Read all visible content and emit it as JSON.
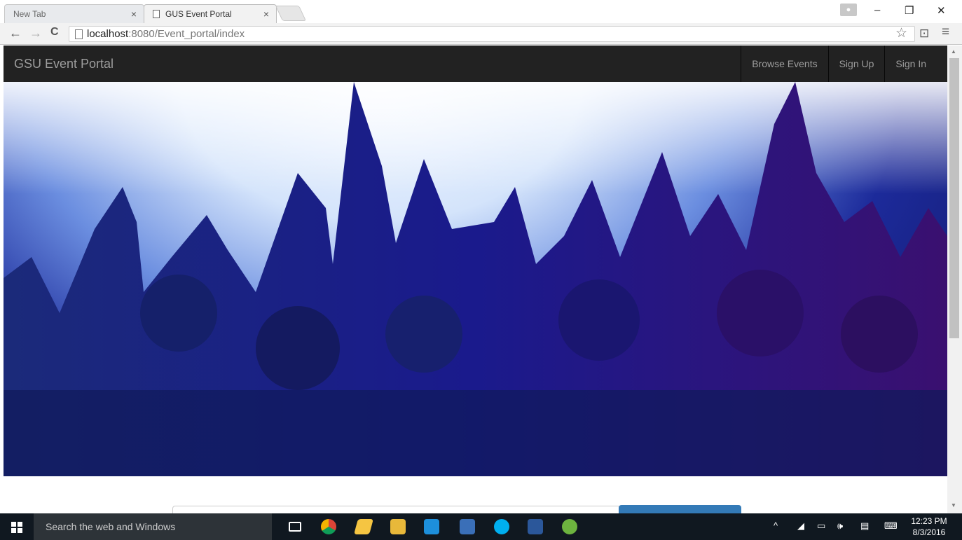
{
  "tabs": [
    {
      "title": "New Tab",
      "close": "×"
    },
    {
      "title": "GUS Event Portal",
      "close": "×"
    }
  ],
  "toolbar": {
    "back": "←",
    "forward": "→",
    "reload": "C",
    "url_host": "localhost",
    "url_path": ":8080/Event_portal/index",
    "star": "☆",
    "cast": "⊡",
    "menu": "≡"
  },
  "window_controls": {
    "minimize": "–",
    "restore": "❐",
    "close": "✕"
  },
  "page": {
    "brand": "GSU Event Portal",
    "nav": [
      "Browse Events",
      "Sign Up",
      "Sign In"
    ]
  },
  "taskbar": {
    "search_placeholder": "Search the web and Windows",
    "time": "12:23 PM",
    "date": "8/3/2016",
    "tray": {
      "chevron": "^",
      "volume": "🕪",
      "notif": "▤"
    }
  },
  "colors": {
    "navbar_bg": "#222222",
    "nav_text": "#9d9d9d",
    "primary_button": "#337ab7"
  }
}
